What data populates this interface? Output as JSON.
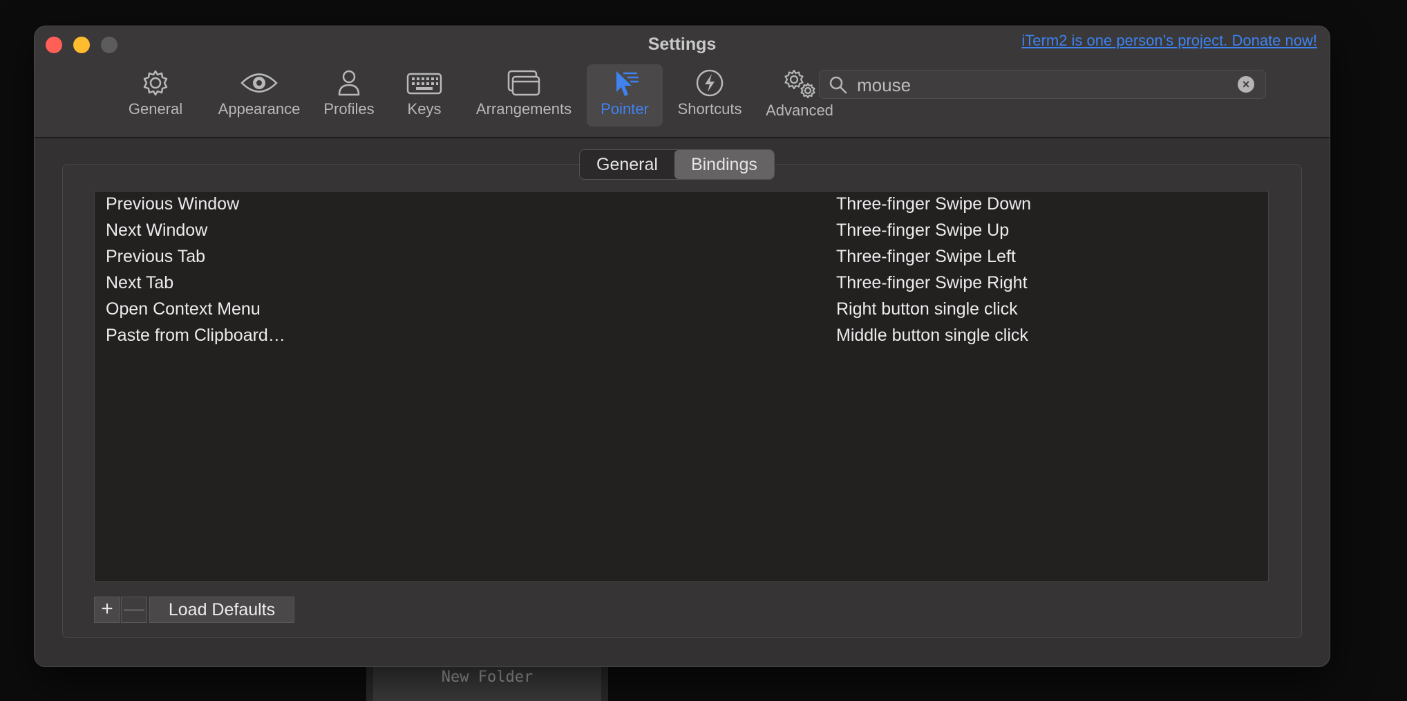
{
  "window": {
    "title": "Settings",
    "donate_link": "iTerm2 is one person’s project. Donate now!"
  },
  "toolbar": {
    "items": [
      {
        "label": "General",
        "icon": "gear-icon"
      },
      {
        "label": "Appearance",
        "icon": "eye-icon"
      },
      {
        "label": "Profiles",
        "icon": "person-icon"
      },
      {
        "label": "Keys",
        "icon": "keyboard-icon"
      },
      {
        "label": "Arrangements",
        "icon": "windows-icon"
      },
      {
        "label": "Pointer",
        "icon": "pointer-icon",
        "active": true
      },
      {
        "label": "Shortcuts",
        "icon": "bolt-icon"
      },
      {
        "label": "Advanced",
        "icon": "gears-icon"
      }
    ],
    "active_color": "#3f82f0"
  },
  "search": {
    "value": "mouse"
  },
  "tabs": {
    "general": "General",
    "bindings": "Bindings",
    "active": "Bindings"
  },
  "bindings": [
    {
      "action": "Previous Window",
      "trigger": "Three-finger Swipe Down"
    },
    {
      "action": "Next Window",
      "trigger": "Three-finger Swipe Up"
    },
    {
      "action": "Previous Tab",
      "trigger": "Three-finger Swipe Left"
    },
    {
      "action": "Next Tab",
      "trigger": "Three-finger Swipe Right"
    },
    {
      "action": "Open Context Menu",
      "trigger": "Right button single click"
    },
    {
      "action": "Paste from Clipboard…",
      "trigger": "Middle button single click"
    }
  ],
  "footer": {
    "add_label": "+",
    "remove_label": "—",
    "load_defaults_label": "Load Defaults"
  },
  "background": {
    "folder_label": "New Folder"
  }
}
